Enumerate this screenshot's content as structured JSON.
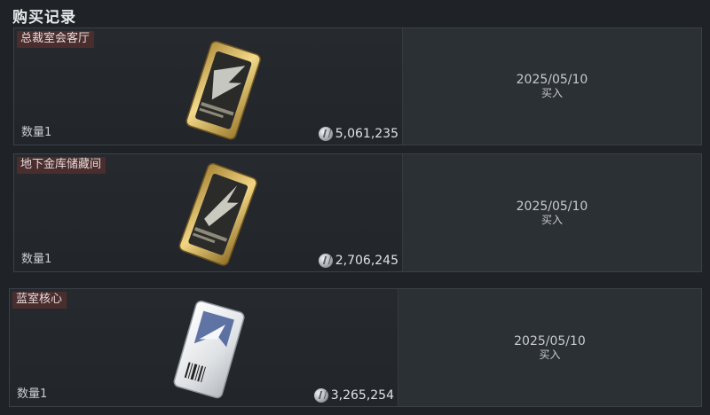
{
  "page": {
    "title": "购买记录"
  },
  "records": [
    {
      "name": "总裁室会客厅",
      "quantity": "数量1",
      "price": "5,061,235",
      "date": "2025/05/10",
      "action": "买入",
      "card_style": "gold",
      "icon": "gold-keycard-icon"
    },
    {
      "name": "地下金库储藏间",
      "quantity": "数量1",
      "price": "2,706,245",
      "date": "2025/05/10",
      "action": "买入",
      "card_style": "gold",
      "icon": "gold-keycard-icon"
    },
    {
      "name": "蓝室核心",
      "quantity": "数量1",
      "price": "3,265,254",
      "date": "2025/05/10",
      "action": "买入",
      "card_style": "white",
      "icon": "white-keycard-icon"
    }
  ],
  "currency_icon": "silver-coin-icon",
  "colors": {
    "background": "#1f2327",
    "name_tag": "#4a2d2d",
    "gold_card": "#c9a84a",
    "white_card": "#e6e8ea"
  }
}
